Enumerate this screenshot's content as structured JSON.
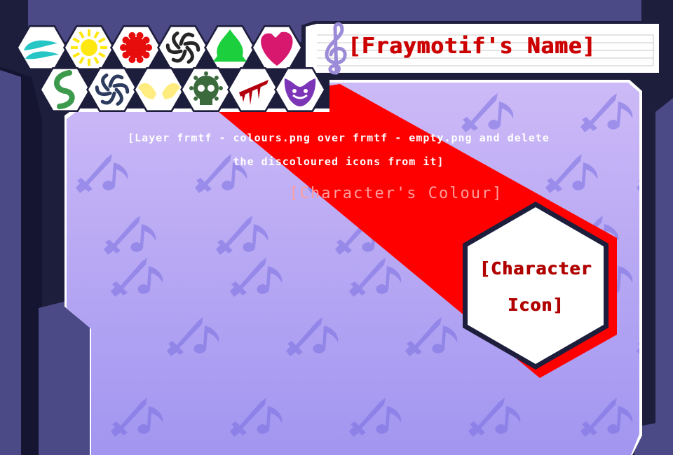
{
  "title": "[Fraymotif's Name]",
  "instructions": {
    "line1": "[Layer frmtf - colours.png over frmtf - empty.png and delete",
    "line2": "the discoloured icons from it]"
  },
  "character_colour_label": "[Character's Colour]",
  "character_icon_label": {
    "line1": "[Character",
    "line2": "Icon]"
  },
  "colors": {
    "frame_dark": "#1d1d3c",
    "frame_mid": "#4c4a86",
    "panel_top": "#cdbaf7",
    "panel_bottom": "#9d8ff0",
    "stripe": "#ff0000",
    "pattern": "#7a70e0",
    "title_text": "#cc0000"
  },
  "aspect_icons": [
    {
      "name": "breath-icon",
      "color": "#27c6c6"
    },
    {
      "name": "light-icon",
      "color": "#ffe812"
    },
    {
      "name": "time-icon",
      "color": "#e70d0d"
    },
    {
      "name": "space-icon",
      "color": "#262626"
    },
    {
      "name": "life-icon",
      "color": "#1ccf3c"
    },
    {
      "name": "heart-icon",
      "color": "#d8176e"
    },
    {
      "name": "life-swirl-icon",
      "color": "#3c9a4d"
    },
    {
      "name": "void-icon",
      "color": "#2d3c5e"
    },
    {
      "name": "hope-icon",
      "color": "#ffec80"
    },
    {
      "name": "doom-icon",
      "color": "#3b6a3d"
    },
    {
      "name": "blood-icon",
      "color": "#b3000e"
    },
    {
      "name": "rage-icon",
      "color": "#7d35b7"
    }
  ],
  "music_icon": {
    "name": "treble-clef-icon",
    "color": "#9b8bd8"
  }
}
